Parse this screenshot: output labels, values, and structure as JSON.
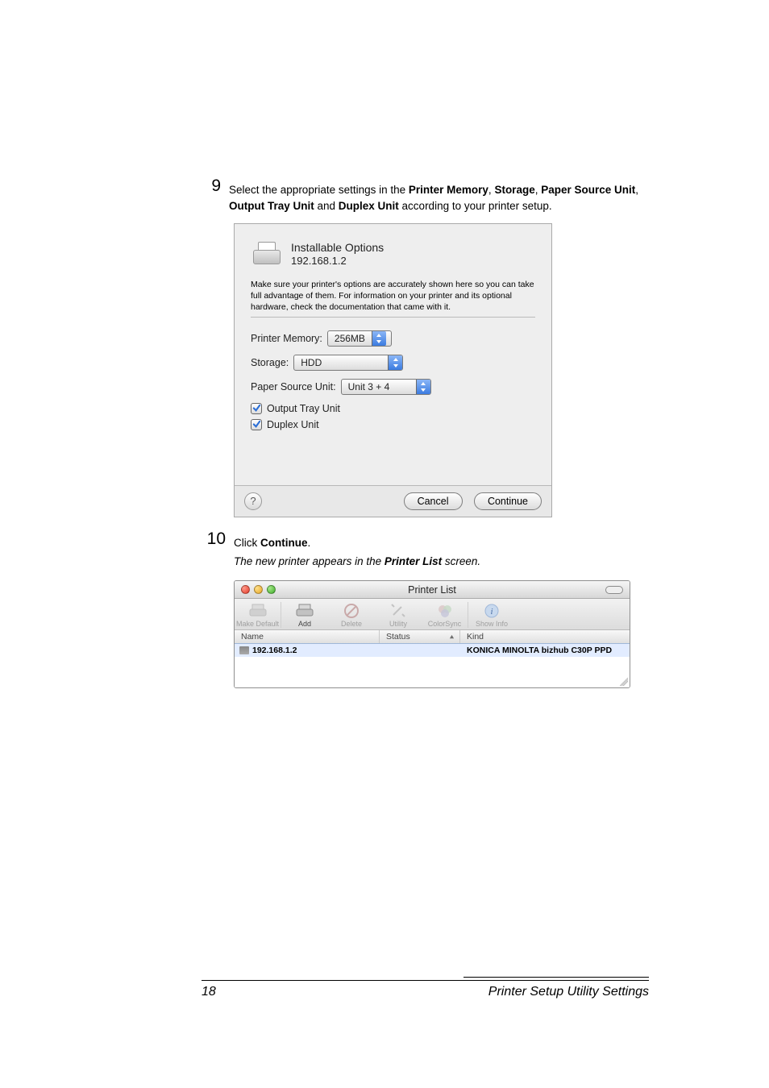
{
  "step9": {
    "number": "9",
    "text_pre": "Select the appropriate settings in the ",
    "b1": "Printer Memory",
    "c1": ", ",
    "b2": "Storage",
    "c2": ", ",
    "b3": "Paper Source Unit",
    "c3": ", ",
    "b4": "Output Tray Unit",
    "c4": " and ",
    "b5": "Duplex Unit",
    "text_post": " according to your printer setup."
  },
  "dialog": {
    "title": "Installable Options",
    "address": "192.168.1.2",
    "note": "Make sure your printer's options are accurately shown here so you can take full advantage of them.  For information on your printer and its optional hardware, check the documentation that came with it.",
    "mem_label": "Printer Memory:",
    "mem_value": "256MB",
    "storage_label": "Storage:",
    "storage_value": "HDD",
    "psu_label": "Paper Source Unit:",
    "psu_value": "Unit 3 + 4",
    "chk_output": "Output Tray Unit",
    "chk_duplex": "Duplex Unit",
    "help": "?",
    "cancel": "Cancel",
    "continue": "Continue"
  },
  "step10": {
    "number": "10",
    "text_pre": "Click ",
    "b1": "Continue",
    "text_post": ".",
    "italic_pre": "The new printer appears in the ",
    "italic_b": "Printer List",
    "italic_post": " screen."
  },
  "listwin": {
    "title": "Printer List",
    "toolbar": {
      "make_default": "Make Default",
      "add": "Add",
      "delete": "Delete",
      "utility": "Utility",
      "colorsync": "ColorSync",
      "show_info": "Show Info"
    },
    "headers": {
      "name": "Name",
      "status": "Status",
      "kind": "Kind"
    },
    "row": {
      "name": "192.168.1.2",
      "kind": "KONICA MINOLTA bizhub C30P PPD"
    }
  },
  "footer": {
    "page": "18",
    "label": "Printer Setup Utility Settings"
  }
}
